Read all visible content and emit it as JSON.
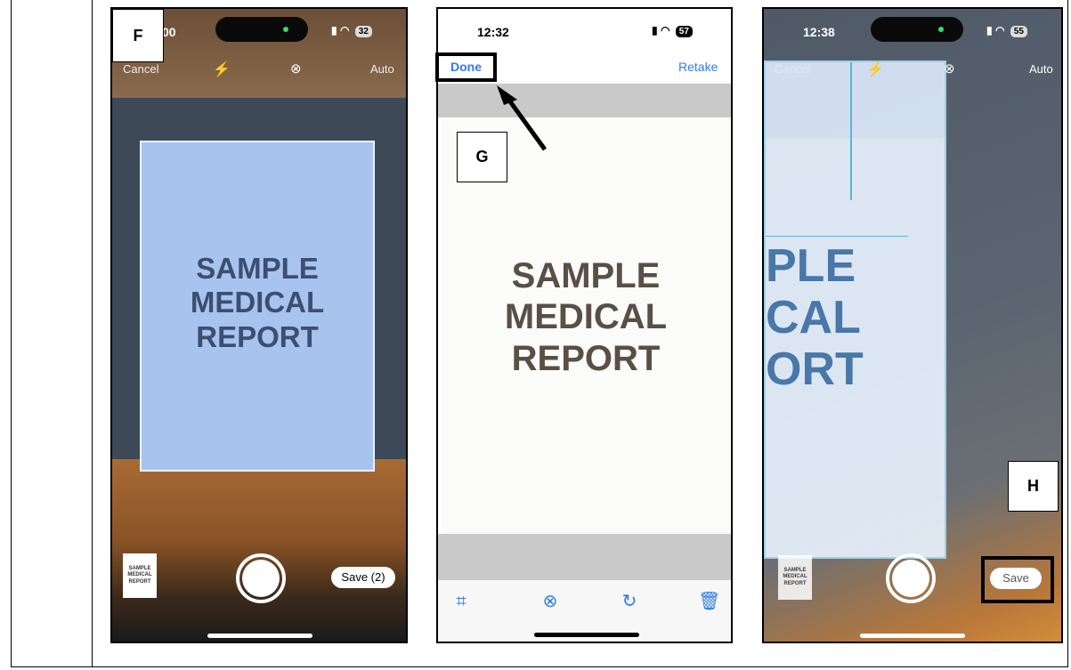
{
  "panel_f": {
    "label": "F",
    "time_fragment": "00",
    "battery": "32",
    "top": {
      "cancel": "Cancel",
      "auto": "Auto"
    },
    "document_lines": [
      "SAMPLE",
      "MEDICAL",
      "REPORT"
    ],
    "thumbnail_lines": [
      "SAMPLE",
      "MEDICAL",
      "REPORT"
    ],
    "save_button": "Save (2)"
  },
  "panel_g": {
    "label": "G",
    "time": "12:32",
    "battery": "57",
    "done": "Done",
    "retake": "Retake",
    "document_lines": [
      "SAMPLE",
      "MEDICAL",
      "REPORT"
    ]
  },
  "panel_h": {
    "label": "H",
    "time": "12:38",
    "battery": "55",
    "top": {
      "cancel": "Cancel",
      "auto": "Auto"
    },
    "document_lines": [
      "PLE",
      "CAL",
      "ORT"
    ],
    "thumbnail_lines": [
      "SAMPLE",
      "MEDICAL",
      "REPORT"
    ],
    "save_button": "Save"
  },
  "colors": {
    "ios_blue": "#2f7bea",
    "scan_overlay": "#a7c3ee",
    "callout": "#000000"
  },
  "icons": [
    "flash-icon",
    "filter-icon",
    "crop-icon",
    "rotate-icon",
    "trash-icon",
    "signal-icon",
    "wifi-icon"
  ]
}
